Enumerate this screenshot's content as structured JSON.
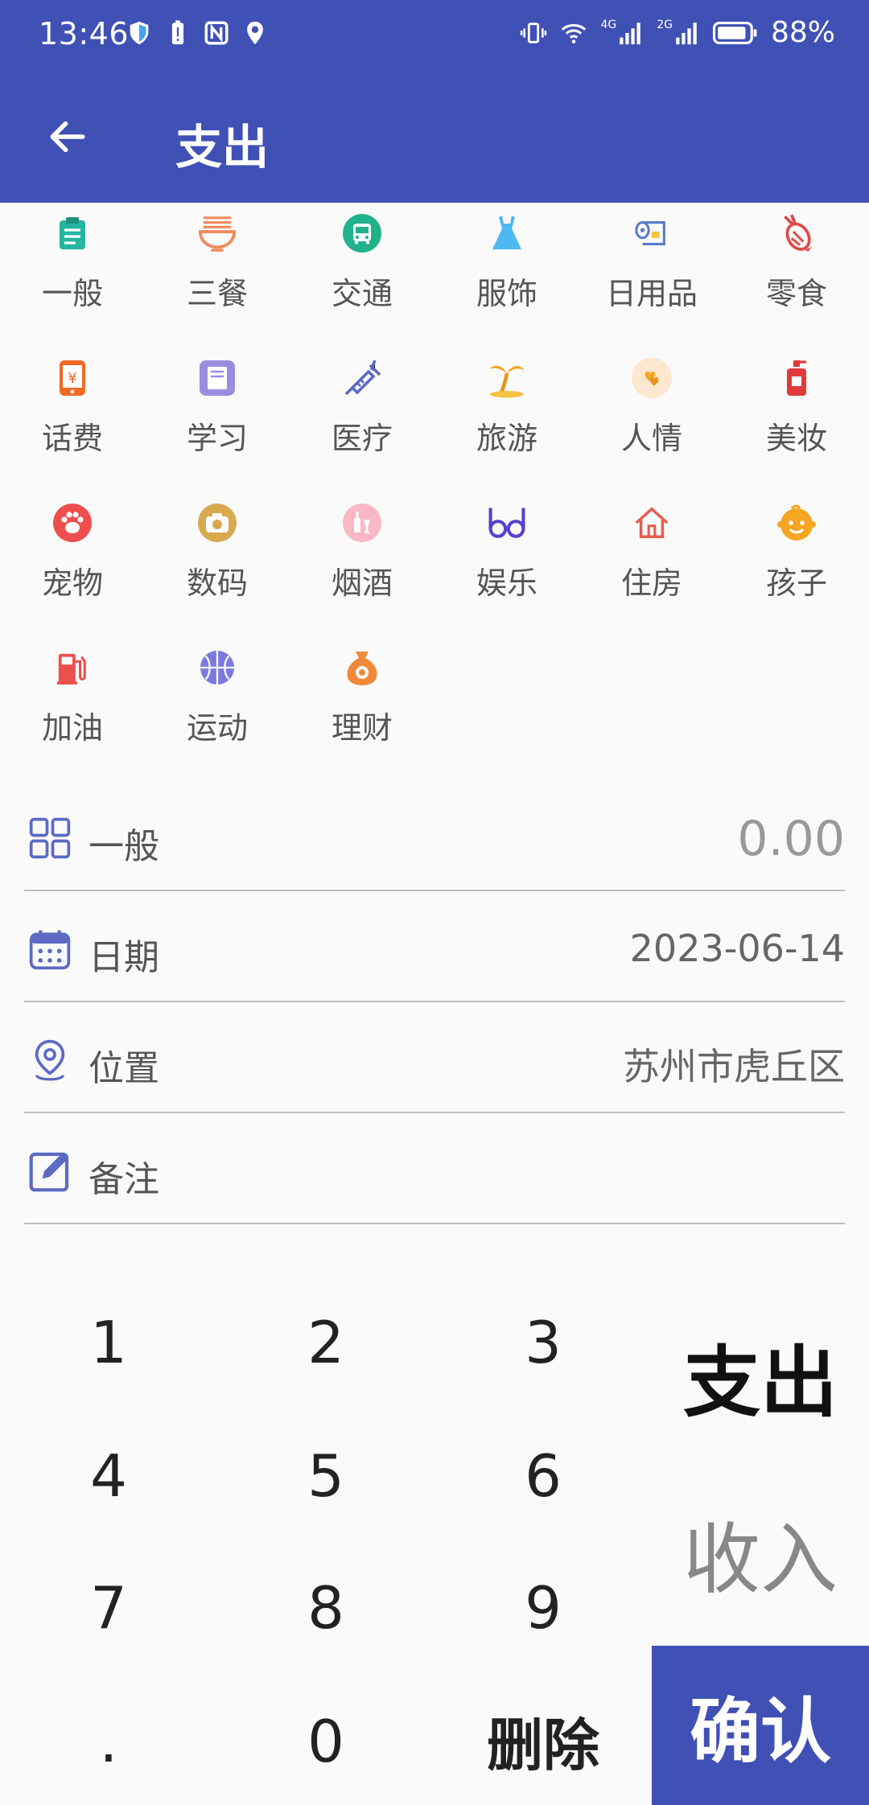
{
  "status_bar": {
    "time": "13:46",
    "battery": "88%",
    "net1": "4G",
    "net2": "2G"
  },
  "toolbar": {
    "back_icon": "arrow-left-icon",
    "title": "支出"
  },
  "categories": [
    {
      "label": "一般",
      "icon": "clipboard-icon",
      "color": "#26b5a0"
    },
    {
      "label": "三餐",
      "icon": "noodle-bowl-icon",
      "color": "#f08a5d"
    },
    {
      "label": "交通",
      "icon": "bus-icon",
      "color": "#20b28a"
    },
    {
      "label": "服饰",
      "icon": "dress-icon",
      "color": "#4fb8f0"
    },
    {
      "label": "日用品",
      "icon": "tissue-roll-icon",
      "color": "#5b7ac9"
    },
    {
      "label": "零食",
      "icon": "candy-icon",
      "color": "#e04a4a"
    },
    {
      "label": "话费",
      "icon": "phone-icon",
      "color": "#f06a24"
    },
    {
      "label": "学习",
      "icon": "book-icon",
      "color": "#9b8ce0"
    },
    {
      "label": "医疗",
      "icon": "syringe-icon",
      "color": "#5c6ac4"
    },
    {
      "label": "旅游",
      "icon": "palm-tree-icon",
      "color": "#f5a623"
    },
    {
      "label": "人情",
      "icon": "hearts-icon",
      "color": "#f5a623"
    },
    {
      "label": "美妆",
      "icon": "perfume-icon",
      "color": "#e03a3a"
    },
    {
      "label": "宠物",
      "icon": "paw-icon",
      "color": "#ef4e4e"
    },
    {
      "label": "数码",
      "icon": "camera-icon",
      "color": "#d9a94e"
    },
    {
      "label": "烟酒",
      "icon": "bottle-glass-icon",
      "color": "#f48fa8"
    },
    {
      "label": "娱乐",
      "icon": "glasses-icon",
      "color": "#5b3fd0"
    },
    {
      "label": "住房",
      "icon": "house-icon",
      "color": "#e85a4a"
    },
    {
      "label": "孩子",
      "icon": "child-face-icon",
      "color": "#f5a623"
    },
    {
      "label": "加油",
      "icon": "fuel-pump-icon",
      "color": "#ef4e4e"
    },
    {
      "label": "运动",
      "icon": "basketball-icon",
      "color": "#7a7ae0"
    },
    {
      "label": "理财",
      "icon": "money-bag-icon",
      "color": "#f08a3a"
    }
  ],
  "form": {
    "category": {
      "icon": "grid-icon",
      "label": "一般",
      "amount": "0.00"
    },
    "date": {
      "icon": "calendar-icon",
      "label": "日期",
      "value": "2023-06-14"
    },
    "location": {
      "icon": "location-pin-icon",
      "label": "位置",
      "value": "苏州市虎丘区"
    },
    "note": {
      "icon": "edit-note-icon",
      "label": "备注",
      "value": ""
    }
  },
  "keypad": {
    "keys": [
      "1",
      "2",
      "3",
      "4",
      "5",
      "6",
      "7",
      "8",
      "9",
      ".",
      "0",
      "删除"
    ],
    "expense_label": "支出",
    "income_label": "收入",
    "confirm_label": "确认"
  },
  "colors": {
    "primary": "#3f51b5",
    "background": "#fafafa",
    "divider": "#bdbdbd"
  }
}
